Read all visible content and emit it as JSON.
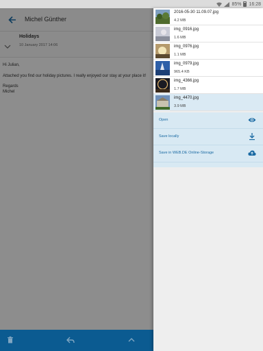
{
  "status": {
    "battery": "85%",
    "time": "16:28"
  },
  "email": {
    "sender": "Michel Günther",
    "subject": "Holidays",
    "date": "10 January 2017 14:06",
    "greeting": "Hi Julian,",
    "message": "Attached you find our holiday pictures. I really enjoyed our stay at your place it!",
    "closing": "Regards\nMichel"
  },
  "attachments": [
    {
      "name": "2016-05-30 11.09.07.jpg",
      "size": "4.2 MB",
      "thumb": "landscape-trees"
    },
    {
      "name": "img_0916.jpg",
      "size": "1.6 MB",
      "thumb": "sky-haze"
    },
    {
      "name": "img_0976.jpg",
      "size": "1.1 MB",
      "thumb": "sunset"
    },
    {
      "name": "img_0979.jpg",
      "size": "965.4 KB",
      "thumb": "blue-sky"
    },
    {
      "name": "img_4366.jpg",
      "size": "1.7 MB",
      "thumb": "ferris-wheel"
    },
    {
      "name": "img_4470.jpg",
      "size": "3.9 MB",
      "thumb": "building"
    }
  ],
  "actions": {
    "open": "Open",
    "save_locally": "Save locally",
    "save_cloud": "Save in WEB.DE Online-Storage"
  },
  "colors": {
    "accent": "#1a6aa3",
    "bottombar": "#0b5b91",
    "selected": "#daeaf4"
  }
}
